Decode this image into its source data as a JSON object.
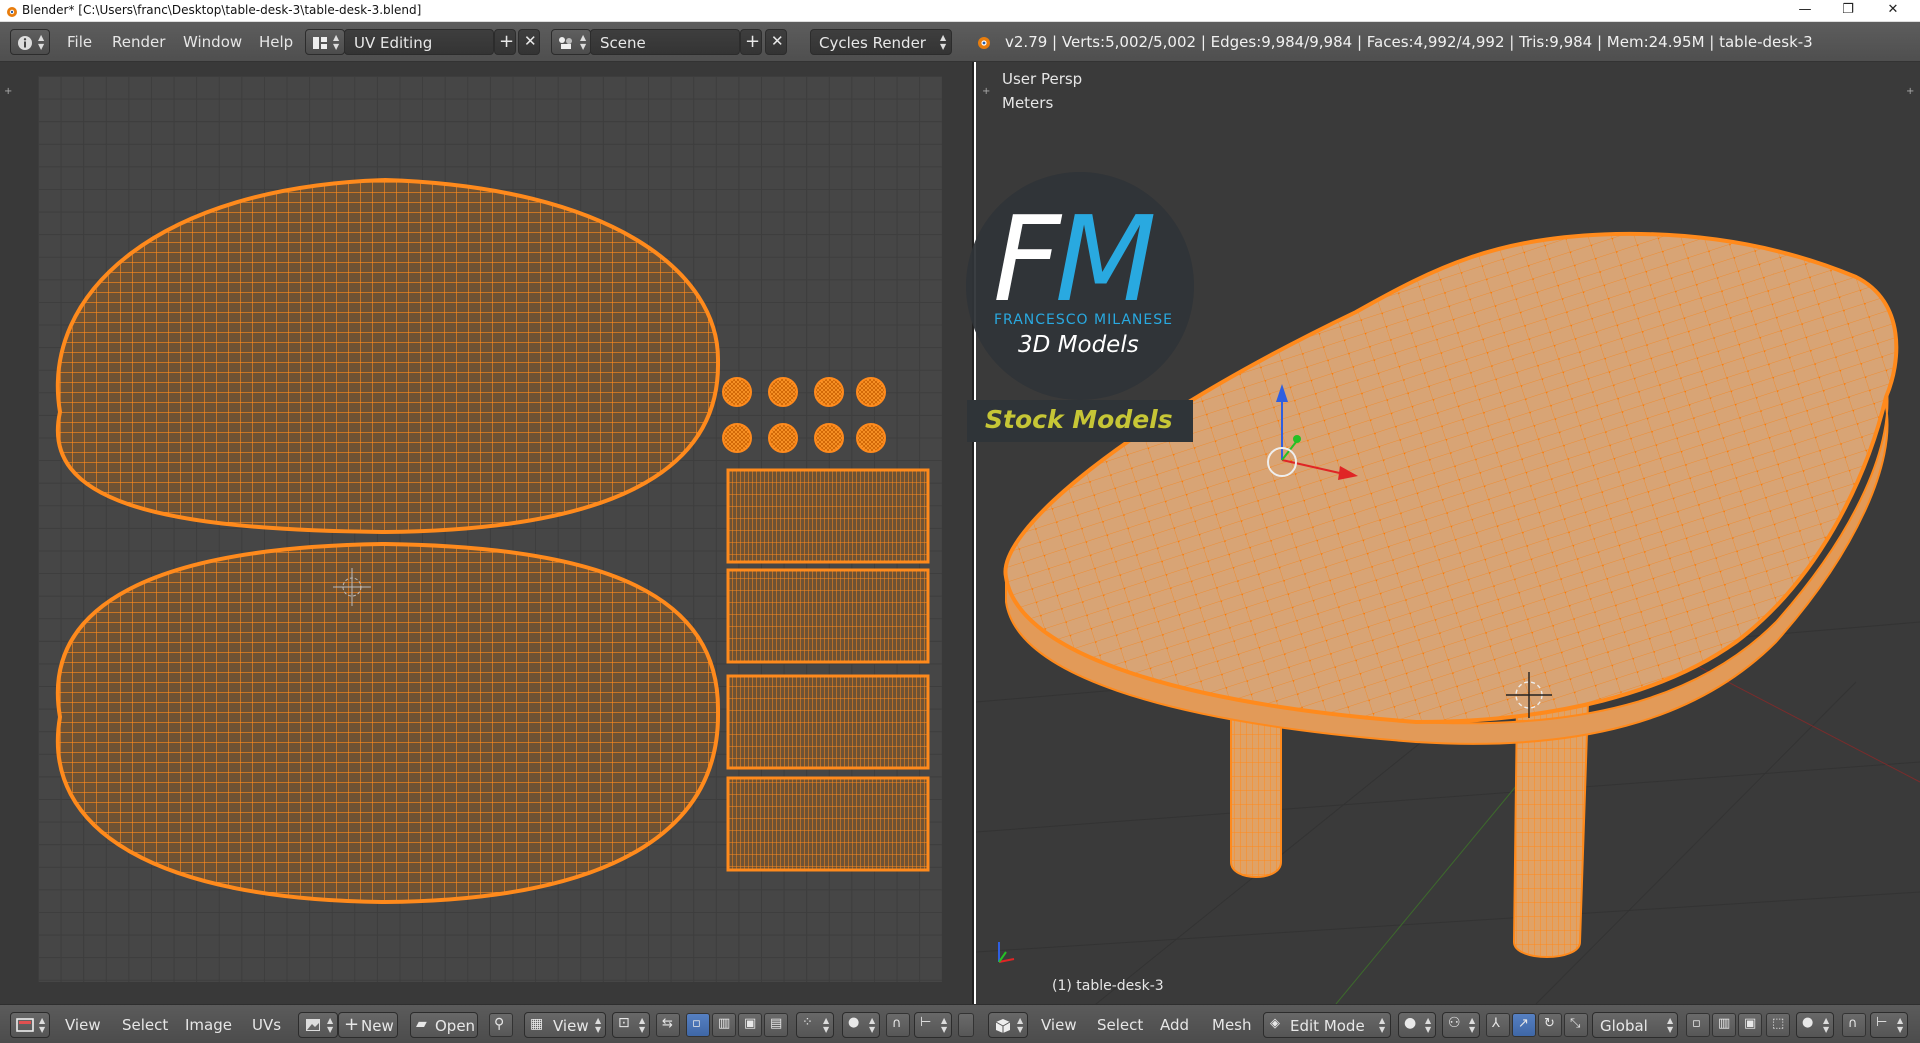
{
  "window": {
    "title": "Blender* [C:\\Users\\franc\\Desktop\\table-desk-3\\table-desk-3.blend]",
    "minimize": "—",
    "maximize": "❐",
    "close": "✕"
  },
  "menubar": {
    "items": [
      "File",
      "Render",
      "Window",
      "Help"
    ],
    "screen_layout": "UV Editing",
    "scene": "Scene",
    "render_engine": "Cycles Render",
    "stats": "v2.79 | Verts:5,002/5,002 | Edges:9,984/9,984 | Faces:4,992/4,992 | Tris:9,984 | Mem:24.95M | table-desk-3"
  },
  "viewport": {
    "view_name": "User Persp",
    "units": "Meters",
    "object_label": "(1) table-desk-3"
  },
  "logo": {
    "letter_f": "F",
    "letter_m": "M",
    "name": "FRANCESCO MILANESE",
    "subtitle": "3D Models",
    "stock": "Stock Models"
  },
  "uv_header": {
    "items": [
      "View",
      "Select",
      "Image",
      "UVs"
    ],
    "new_label": "New",
    "open_label": "Open",
    "view_label": "View"
  },
  "view3d_header": {
    "items": [
      "View",
      "Select",
      "Add",
      "Mesh"
    ],
    "mode": "Edit Mode",
    "orientation": "Global"
  },
  "colors": {
    "mesh_orange": "#ff8a1c",
    "uv_fill": "#7a5a3a",
    "accent_blue": "#29a9e0",
    "logo_green": "#c6c636"
  }
}
